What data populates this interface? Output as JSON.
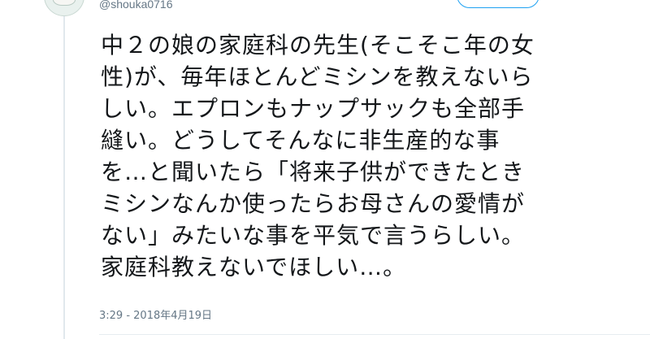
{
  "tweet": {
    "handle": "@shouka0716",
    "text_lines": [
      "中２の娘の家庭科の先生(そこそこ年の女",
      "性)が、毎年ほとんどミシンを教えないら",
      "しい。エプロンもナップサックも全部手",
      "縫い。どうしてそんなに非生産的な事",
      "を…と聞いたら「将来子供ができたとき",
      "ミシンなんか使ったらお母さんの愛情が",
      "ない」みたいな事を平気で言うらしい。",
      "家庭科教えないでほしい…。"
    ],
    "timestamp": "3:29 - 2018年4月19日"
  },
  "colors": {
    "text": "#14171a",
    "secondary_text": "#657786",
    "accent": "#1da1f2",
    "divider": "#e6ecf0"
  }
}
